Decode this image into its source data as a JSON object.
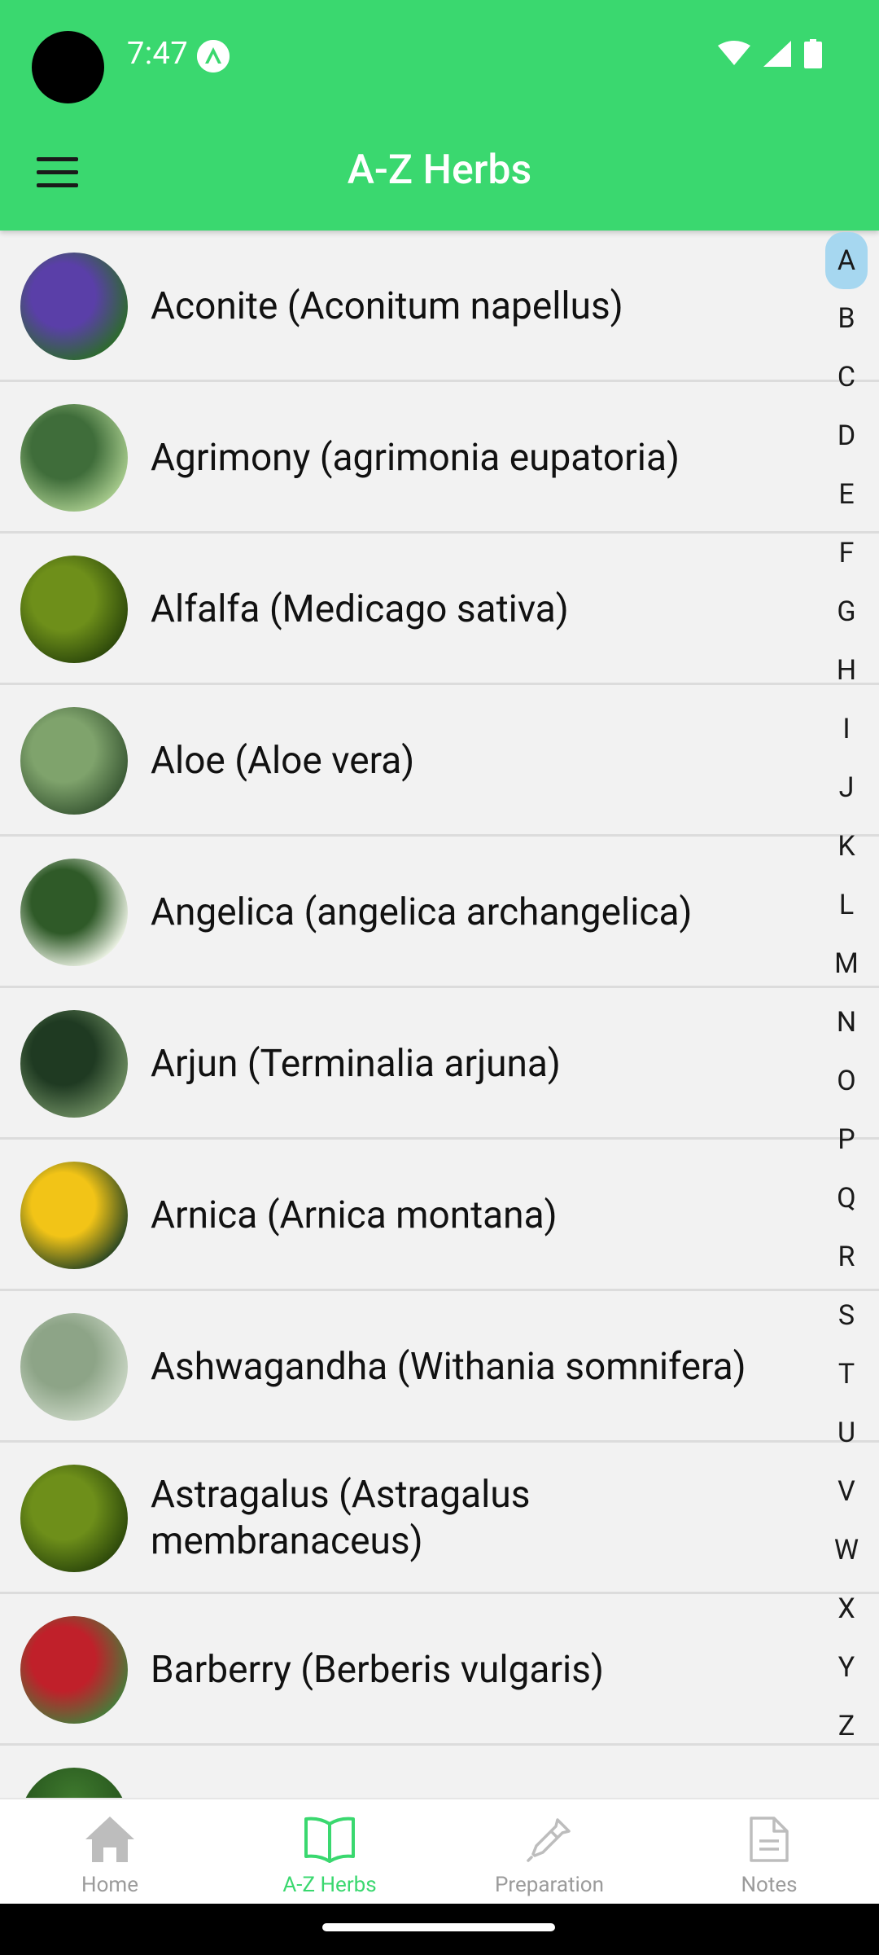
{
  "status_bar": {
    "time": "7:47"
  },
  "app_bar": {
    "title": "A-Z Herbs",
    "menu_icon": "menu-icon"
  },
  "herbs": [
    {
      "name": "Aconite (Aconitum napellus)",
      "thumb_colors": [
        "#5a3fa8",
        "#2d6a2e"
      ]
    },
    {
      "name": "Agrimony (agrimonia eupatoria)",
      "thumb_colors": [
        "#3f6d3a",
        "#a5c98b"
      ]
    },
    {
      "name": "Alfalfa (Medicago sativa)",
      "thumb_colors": [
        "#6e8f1a",
        "#2e4a0b"
      ]
    },
    {
      "name": "Aloe (Aloe vera)",
      "thumb_colors": [
        "#7fa36c",
        "#3b5a35"
      ]
    },
    {
      "name": "Angelica (angelica archangelica)",
      "thumb_colors": [
        "#2f5a28",
        "#e8efe0"
      ]
    },
    {
      "name": "Arjun (Terminalia arjuna)",
      "thumb_colors": [
        "#1f3a22",
        "#6b8a5f"
      ]
    },
    {
      "name": "Arnica (Arnica montana)",
      "thumb_colors": [
        "#f2c417",
        "#2f4a22"
      ]
    },
    {
      "name": "Ashwagandha (Withania somnifera)",
      "thumb_colors": [
        "#8da487",
        "#c7d4c2"
      ]
    },
    {
      "name": "Astragalus (Astragalus membranaceus)",
      "thumb_colors": [
        "#6e8f1a",
        "#2e4a0b"
      ]
    },
    {
      "name": "Barberry (Berberis vulgaris)",
      "thumb_colors": [
        "#c0202a",
        "#4a7a3a"
      ]
    }
  ],
  "alphabet": [
    "A",
    "B",
    "C",
    "D",
    "E",
    "F",
    "G",
    "H",
    "I",
    "J",
    "K",
    "L",
    "M",
    "N",
    "O",
    "P",
    "Q",
    "R",
    "S",
    "T",
    "U",
    "V",
    "W",
    "X",
    "Y",
    "Z"
  ],
  "alphabet_active": "A",
  "bottom_nav": {
    "items": [
      {
        "label": "Home",
        "icon": "home-icon",
        "active": false
      },
      {
        "label": "A-Z Herbs",
        "icon": "book-icon",
        "active": true
      },
      {
        "label": "Preparation",
        "icon": "dropper-icon",
        "active": false
      },
      {
        "label": "Notes",
        "icon": "document-icon",
        "active": false
      }
    ],
    "active_color": "#3ad86f",
    "inactive_color": "#9b9b9b"
  },
  "theme": {
    "primary": "#3ad86f",
    "background": "#f2f2f2"
  }
}
